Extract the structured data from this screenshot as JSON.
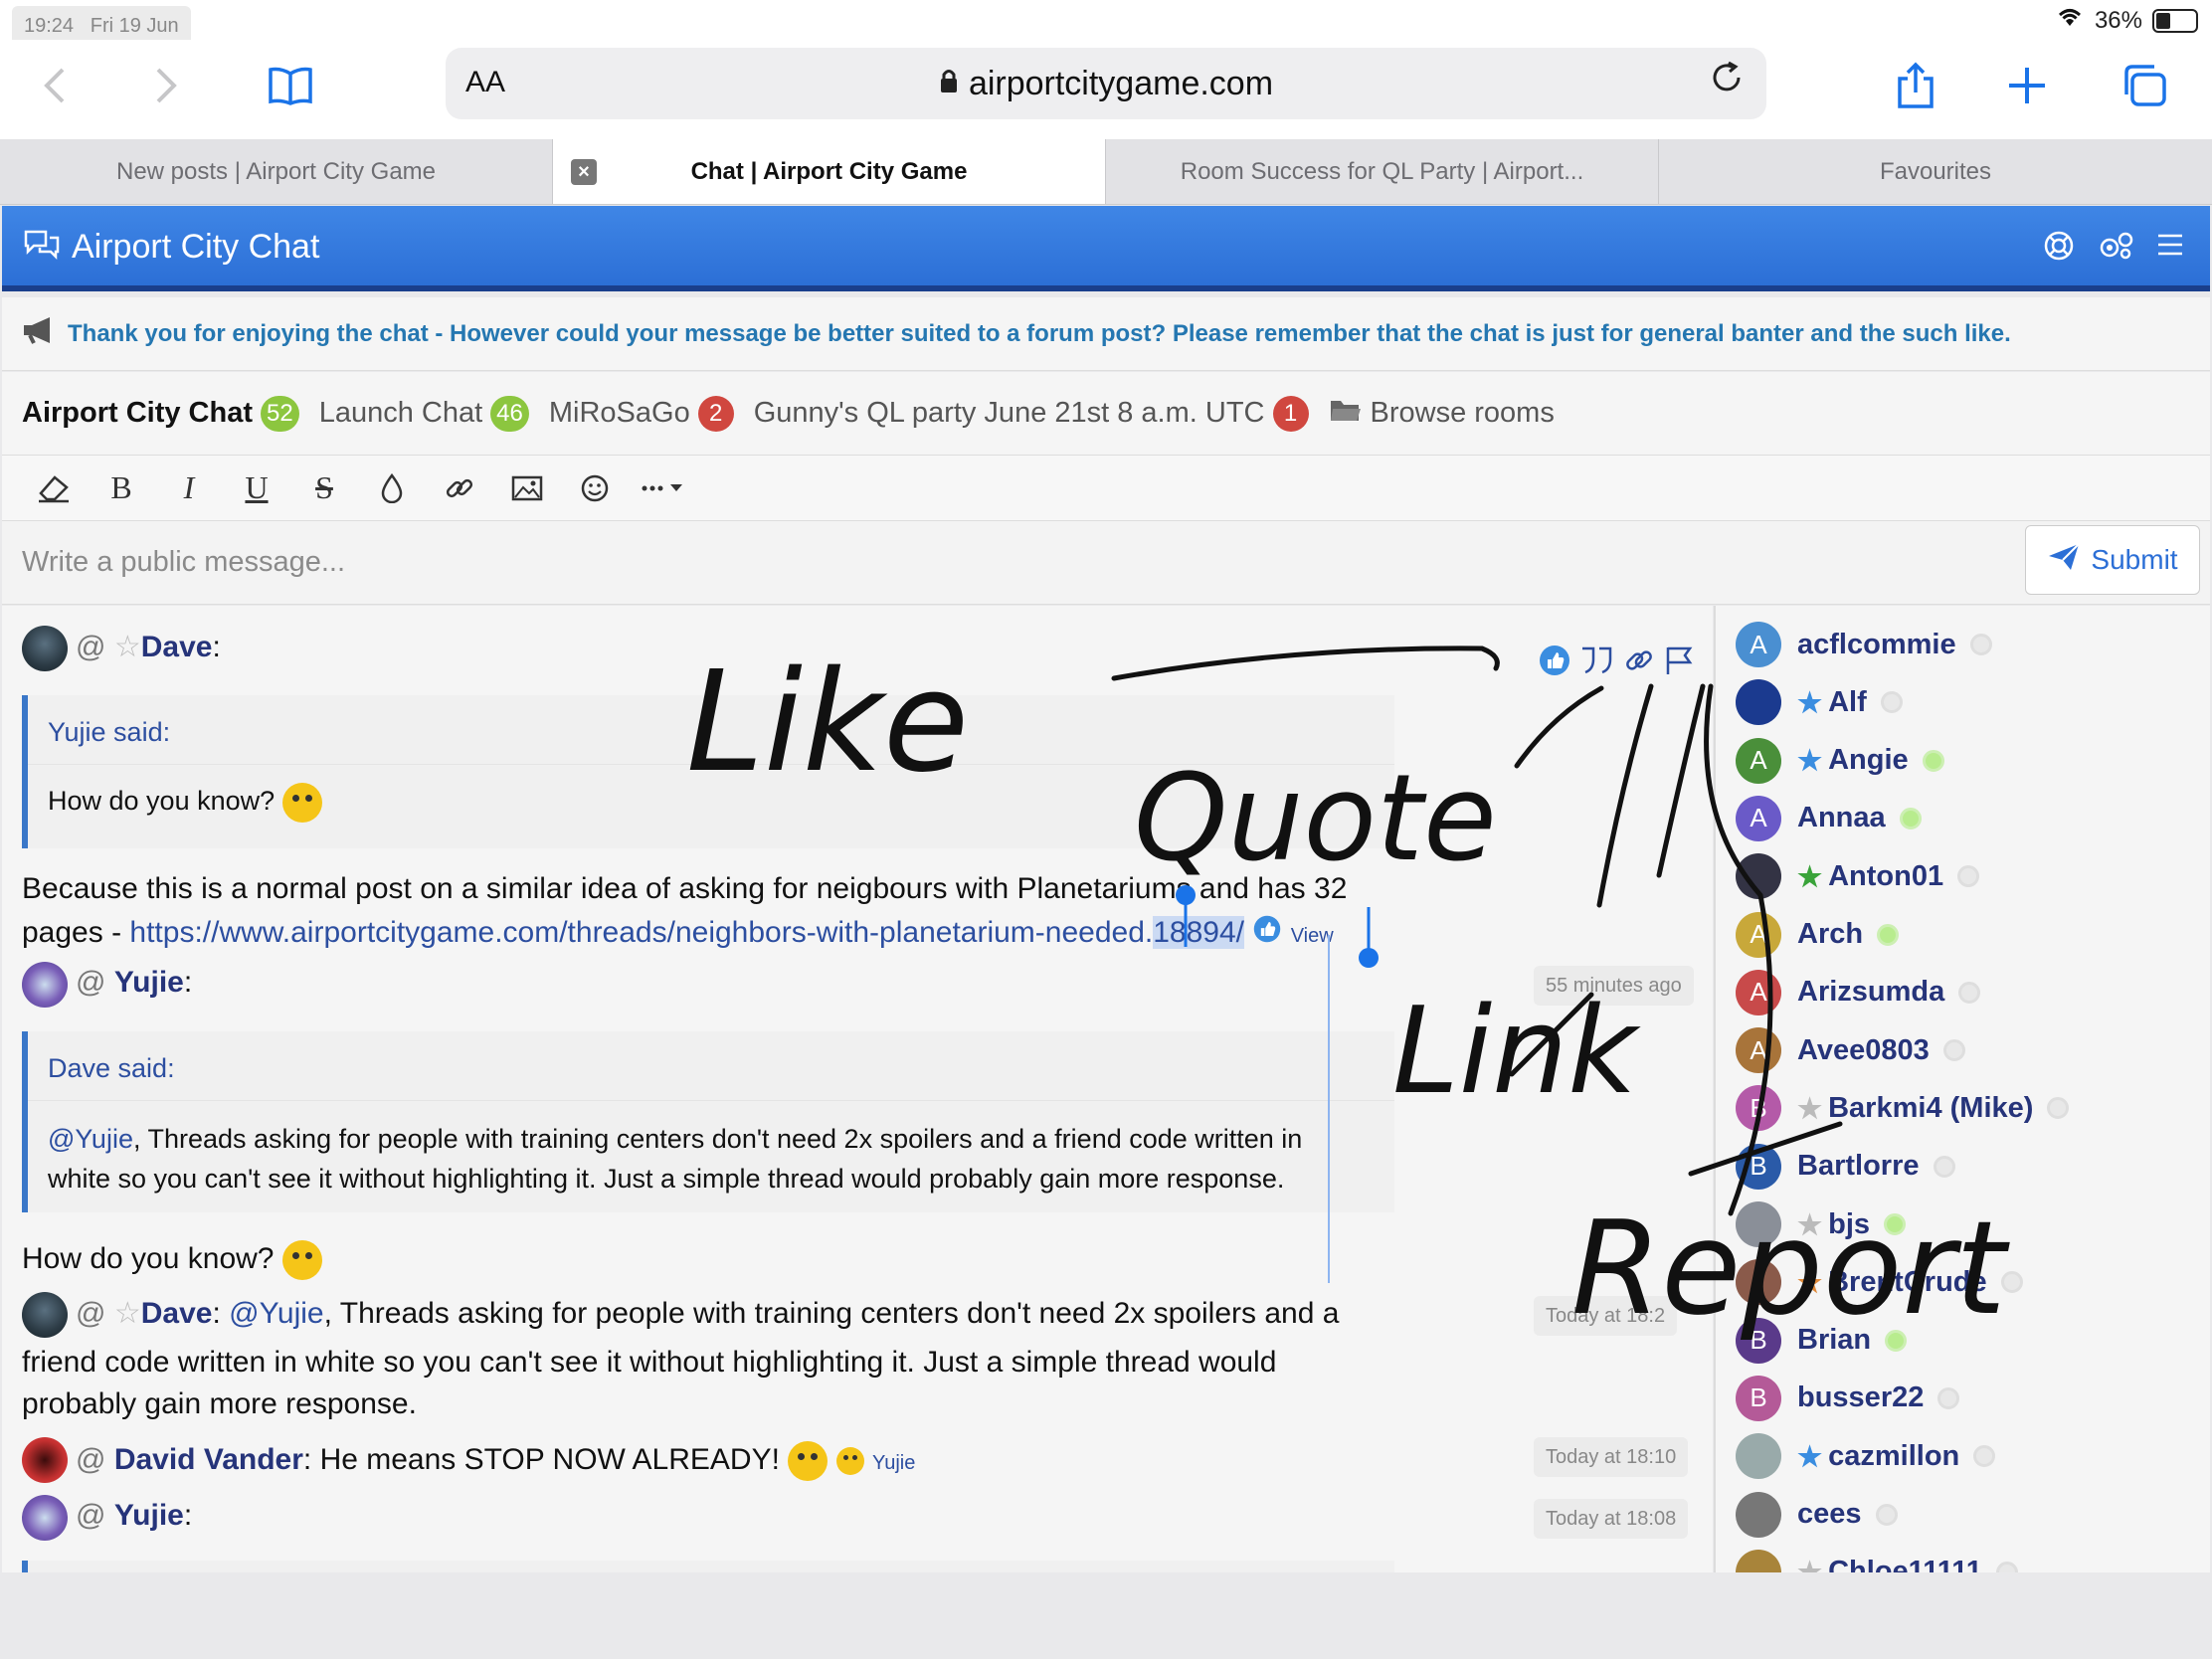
{
  "status": {
    "time": "19:24",
    "date": "Fri 19 Jun",
    "battery": "36%"
  },
  "browser": {
    "text_size_label": "AA",
    "url": "airportcitygame.com",
    "tabs": [
      {
        "label": "New posts | Airport City Game"
      },
      {
        "label": "Chat | Airport City Game"
      },
      {
        "label": "Room Success for QL Party | Airport..."
      },
      {
        "label": "Favourites"
      }
    ],
    "close_symbol": "×"
  },
  "chat": {
    "title": "Airport City Chat",
    "notice": "Thank you for enjoying the chat - However could your message be better suited to a forum post? Please remember that the chat is just for general banter and the such like.",
    "rooms": [
      {
        "name": "Airport City Chat",
        "count": "52"
      },
      {
        "name": "Launch Chat",
        "count": "46"
      },
      {
        "name": "MiRoSaGo",
        "count": "2"
      },
      {
        "name": "Gunny's QL party June 21st 8 a.m. UTC",
        "count": "1"
      }
    ],
    "browse_rooms": "Browse rooms",
    "input_placeholder": "Write a public message...",
    "submit_label": "Submit"
  },
  "messages": {
    "m1": {
      "at": "@",
      "user": "Dave",
      "colon": ":",
      "quote_header": "Yujie said:",
      "quote_body": "How do you know?",
      "line1": "Because this is a normal post on a similar idea of asking for neigbours with Planetariums and has 32",
      "line2_prefix": "pages - ",
      "link": "https://www.airportcitygame.com/threads/neighbors-with-planetarium-needed.",
      "link_end": "18894/",
      "view": "View"
    },
    "m2": {
      "at": "@",
      "user": "Yujie",
      "colon": ":",
      "time": "55 minutes ago",
      "quote_header": "Dave said:",
      "quote_mention": "@Yujie",
      "quote_line1": ", Threads asking for people with training centers don't need 2x spoilers and a friend code written in",
      "quote_line2": "white so you can't see it without highlighting it. Just a simple thread would probably gain more response.",
      "reply": "How do you know?"
    },
    "m3": {
      "at": "@",
      "user": "Dave",
      "colon": ": ",
      "mention": "@Yujie",
      "line1": ", Threads asking for people with training centers don't need 2x spoilers and a",
      "line2": "friend code written in white so you can't see it without highlighting it. Just a simple thread would",
      "line3": "probably gain more response.",
      "time": "Today at 18:2"
    },
    "m4": {
      "at": "@",
      "user": "David Vander",
      "colon": ": ",
      "text": "He means STOP NOW ALREADY!",
      "reactor": "Yujie",
      "time": "Today at 18:10"
    },
    "m5": {
      "at": "@",
      "user": "Yujie",
      "colon": ":",
      "time": "Today at 18:08"
    }
  },
  "users": [
    {
      "name": "acflcommie",
      "initial": "A",
      "color": "#4a8fd1",
      "star": "",
      "online": false
    },
    {
      "name": "Alf",
      "initial": "",
      "color": "#1b3a8f",
      "star": "blue",
      "online": false
    },
    {
      "name": "Angie",
      "initial": "A",
      "color": "#4a8f3a",
      "star": "blue",
      "online": true
    },
    {
      "name": "Annaa",
      "initial": "A",
      "color": "#6a5ac8",
      "star": "",
      "online": true
    },
    {
      "name": "Anton01",
      "initial": "",
      "color": "#334",
      "star": "green",
      "online": false
    },
    {
      "name": "Arch",
      "initial": "A",
      "color": "#c8a83a",
      "star": "",
      "online": true
    },
    {
      "name": "Arizsumda",
      "initial": "A",
      "color": "#c84a4a",
      "star": "",
      "online": false
    },
    {
      "name": "Avee0803",
      "initial": "A",
      "color": "#a8743a",
      "star": "",
      "online": false
    },
    {
      "name": "Barkmi4 (Mike)",
      "initial": "B",
      "color": "#b45aa8",
      "star": "grey",
      "online": false
    },
    {
      "name": "Bartlorre",
      "initial": "B",
      "color": "#2a5aa8",
      "star": "",
      "online": false
    },
    {
      "name": "bjs",
      "initial": "",
      "color": "#8a8f98",
      "star": "grey",
      "online": true
    },
    {
      "name": "BrentCrude",
      "initial": "",
      "color": "#8a5a4a",
      "star": "orange",
      "online": false
    },
    {
      "name": "Brian",
      "initial": "B",
      "color": "#5a3a8a",
      "star": "",
      "online": true
    },
    {
      "name": "busser22",
      "initial": "B",
      "color": "#b45a98",
      "star": "",
      "online": false
    },
    {
      "name": "cazmillon",
      "initial": "",
      "color": "#9aa",
      "star": "blue",
      "online": false
    },
    {
      "name": "cees",
      "initial": "",
      "color": "#777",
      "star": "",
      "online": false
    },
    {
      "name": "Chloe11111",
      "initial": "",
      "color": "#a8843a",
      "star": "grey",
      "online": false
    }
  ],
  "annotations": {
    "like": "Like",
    "quote": "Quote",
    "link": "Link",
    "report": "Report"
  },
  "icons": [
    "back-icon",
    "forward-icon",
    "bookmarks-icon",
    "lock-icon",
    "reload-icon",
    "share-icon",
    "plus-icon",
    "tabs-icon",
    "chat-bubbles-icon",
    "help-icon",
    "settings-icon",
    "menu-icon",
    "megaphone-icon",
    "folder-icon",
    "eraser-icon",
    "bold-icon",
    "italic-icon",
    "underline-icon",
    "strikethrough-icon",
    "color-icon",
    "link-icon",
    "image-icon",
    "smiley-icon",
    "more-icon",
    "send-icon",
    "like-icon",
    "quote-icon",
    "report-icon"
  ]
}
